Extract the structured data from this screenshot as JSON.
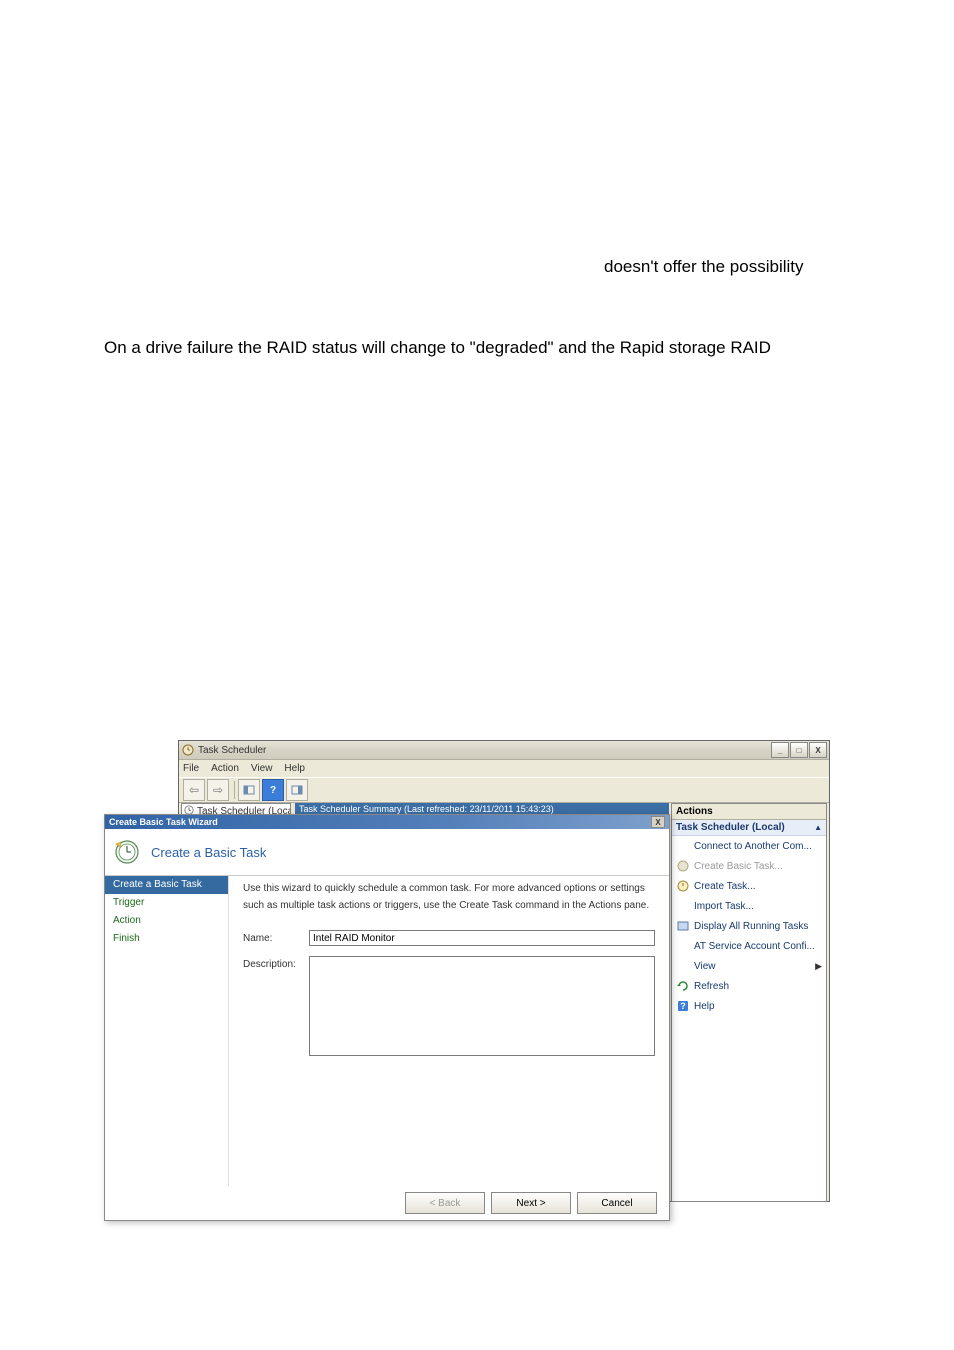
{
  "page": {
    "text1": "doesn't offer the possibility",
    "text2": "On a drive failure the RAID status will change to \"degraded\" and the Rapid storage RAID"
  },
  "window": {
    "title": "Task Scheduler",
    "menu": {
      "file": "File",
      "action": "Action",
      "view": "View",
      "help": "Help"
    },
    "win_btns": {
      "min": "_",
      "max": "□",
      "close": "X"
    },
    "tree": {
      "root": "Task Scheduler (Local)"
    },
    "content_header": "Task Scheduler Summary (Last refreshed: 23/11/2011 15:43:23)"
  },
  "actions": {
    "header": "Actions",
    "sub": "Task Scheduler (Local)",
    "items": [
      {
        "id": "connect",
        "label": "Connect to Another Com...",
        "icon": "link-icon"
      },
      {
        "id": "create_basic",
        "label": "Create Basic Task...",
        "icon": "clock-basic-icon",
        "disabled": true
      },
      {
        "id": "create_task",
        "label": "Create Task...",
        "icon": "clock-icon"
      },
      {
        "id": "import",
        "label": "Import Task...",
        "icon": "import-icon"
      },
      {
        "id": "display_running",
        "label": "Display All Running Tasks",
        "icon": "running-icon"
      },
      {
        "id": "at_config",
        "label": "AT Service Account Confi...",
        "icon": "at-icon"
      },
      {
        "id": "view",
        "label": "View",
        "icon": "view-icon",
        "submenu": true
      },
      {
        "id": "refresh",
        "label": "Refresh",
        "icon": "refresh-icon"
      },
      {
        "id": "help",
        "label": "Help",
        "icon": "help-icon"
      }
    ]
  },
  "wizard": {
    "title": "Create Basic Task Wizard",
    "sub_title": "Create a Basic Task",
    "nav": {
      "step1": "Create a Basic Task",
      "step2": "Trigger",
      "step3": "Action",
      "step4": "Finish"
    },
    "body": {
      "intro1": "Use this wizard to quickly schedule a common task. For more advanced options or settings",
      "intro2": "such as multiple task actions or triggers, use the Create Task command in the Actions pane.",
      "name_label": "Name:",
      "name_value": "Intel RAID Monitor",
      "desc_label": "Description:",
      "desc_value": ""
    },
    "footer": {
      "back": "< Back",
      "next": "Next >",
      "cancel": "Cancel"
    }
  }
}
